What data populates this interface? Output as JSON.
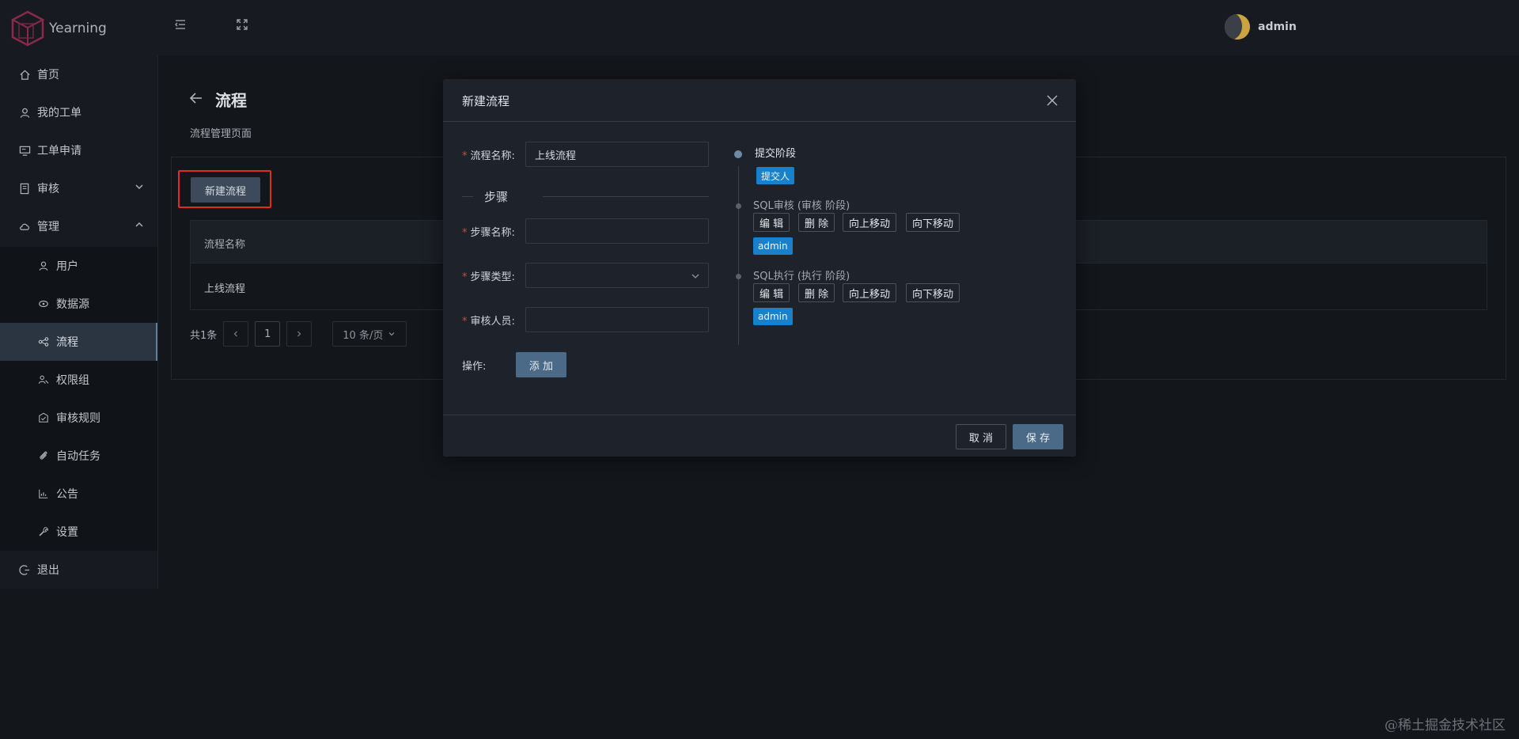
{
  "header": {
    "app_name": "Yearning",
    "user_name": "admin",
    "icons": [
      "menu-toggle-icon",
      "fullscreen-icon"
    ]
  },
  "sidebar": {
    "items": [
      {
        "label": "首页",
        "icon": "home-icon"
      },
      {
        "label": "我的工单",
        "icon": "user-icon"
      },
      {
        "label": "工单申请",
        "icon": "monitor-icon"
      },
      {
        "label": "审核",
        "icon": "audit-icon"
      },
      {
        "label": "管理",
        "icon": "cloud-icon"
      }
    ],
    "sub_items": [
      {
        "label": "用户",
        "icon": "user-icon"
      },
      {
        "label": "数据源",
        "icon": "database-icon"
      },
      {
        "label": "流程",
        "icon": "flow-icon",
        "active": true
      },
      {
        "label": "权限组",
        "icon": "group-icon"
      },
      {
        "label": "审核规则",
        "icon": "rule-icon"
      },
      {
        "label": "自动任务",
        "icon": "clip-icon"
      },
      {
        "label": "公告",
        "icon": "chart-icon"
      },
      {
        "label": "设置",
        "icon": "wrench-icon"
      }
    ],
    "logout": {
      "label": "退出",
      "icon": "logout-icon"
    }
  },
  "page": {
    "title": "流程",
    "subtitle": "流程管理页面",
    "new_button": "新建流程",
    "table": {
      "header": "流程名称",
      "rows": [
        "上线流程"
      ]
    },
    "pager": {
      "total": "共1条",
      "current": "1",
      "size": "10 条/页"
    }
  },
  "modal": {
    "title": "新建流程",
    "form": {
      "flow_name_label": "流程名称:",
      "flow_name_value": "上线流程",
      "steps_divider": "步骤",
      "step_name_label": "步骤名称:",
      "step_type_label": "步骤类型:",
      "reviewer_label": "审核人员:",
      "action_label": "操作:",
      "add_button": "添 加"
    },
    "timeline": [
      {
        "title": "提交阶段",
        "tag": "提交人"
      },
      {
        "title": "SQL审核 (审核 阶段)",
        "buttons": [
          "编 辑",
          "删 除",
          "向上移动",
          "向下移动"
        ],
        "tag": "admin"
      },
      {
        "title": "SQL执行 (执行 阶段)",
        "buttons": [
          "编 辑",
          "删 除",
          "向上移动",
          "向下移动"
        ],
        "tag": "admin"
      }
    ],
    "footer": {
      "cancel": "取 消",
      "save": "保 存"
    }
  },
  "watermark": "@稀土掘金技术社区",
  "colors": {
    "background": "#13161b",
    "accent": "#4b6a88",
    "tag_blue": "#1781cc",
    "highlight_red": "#e02b20"
  }
}
